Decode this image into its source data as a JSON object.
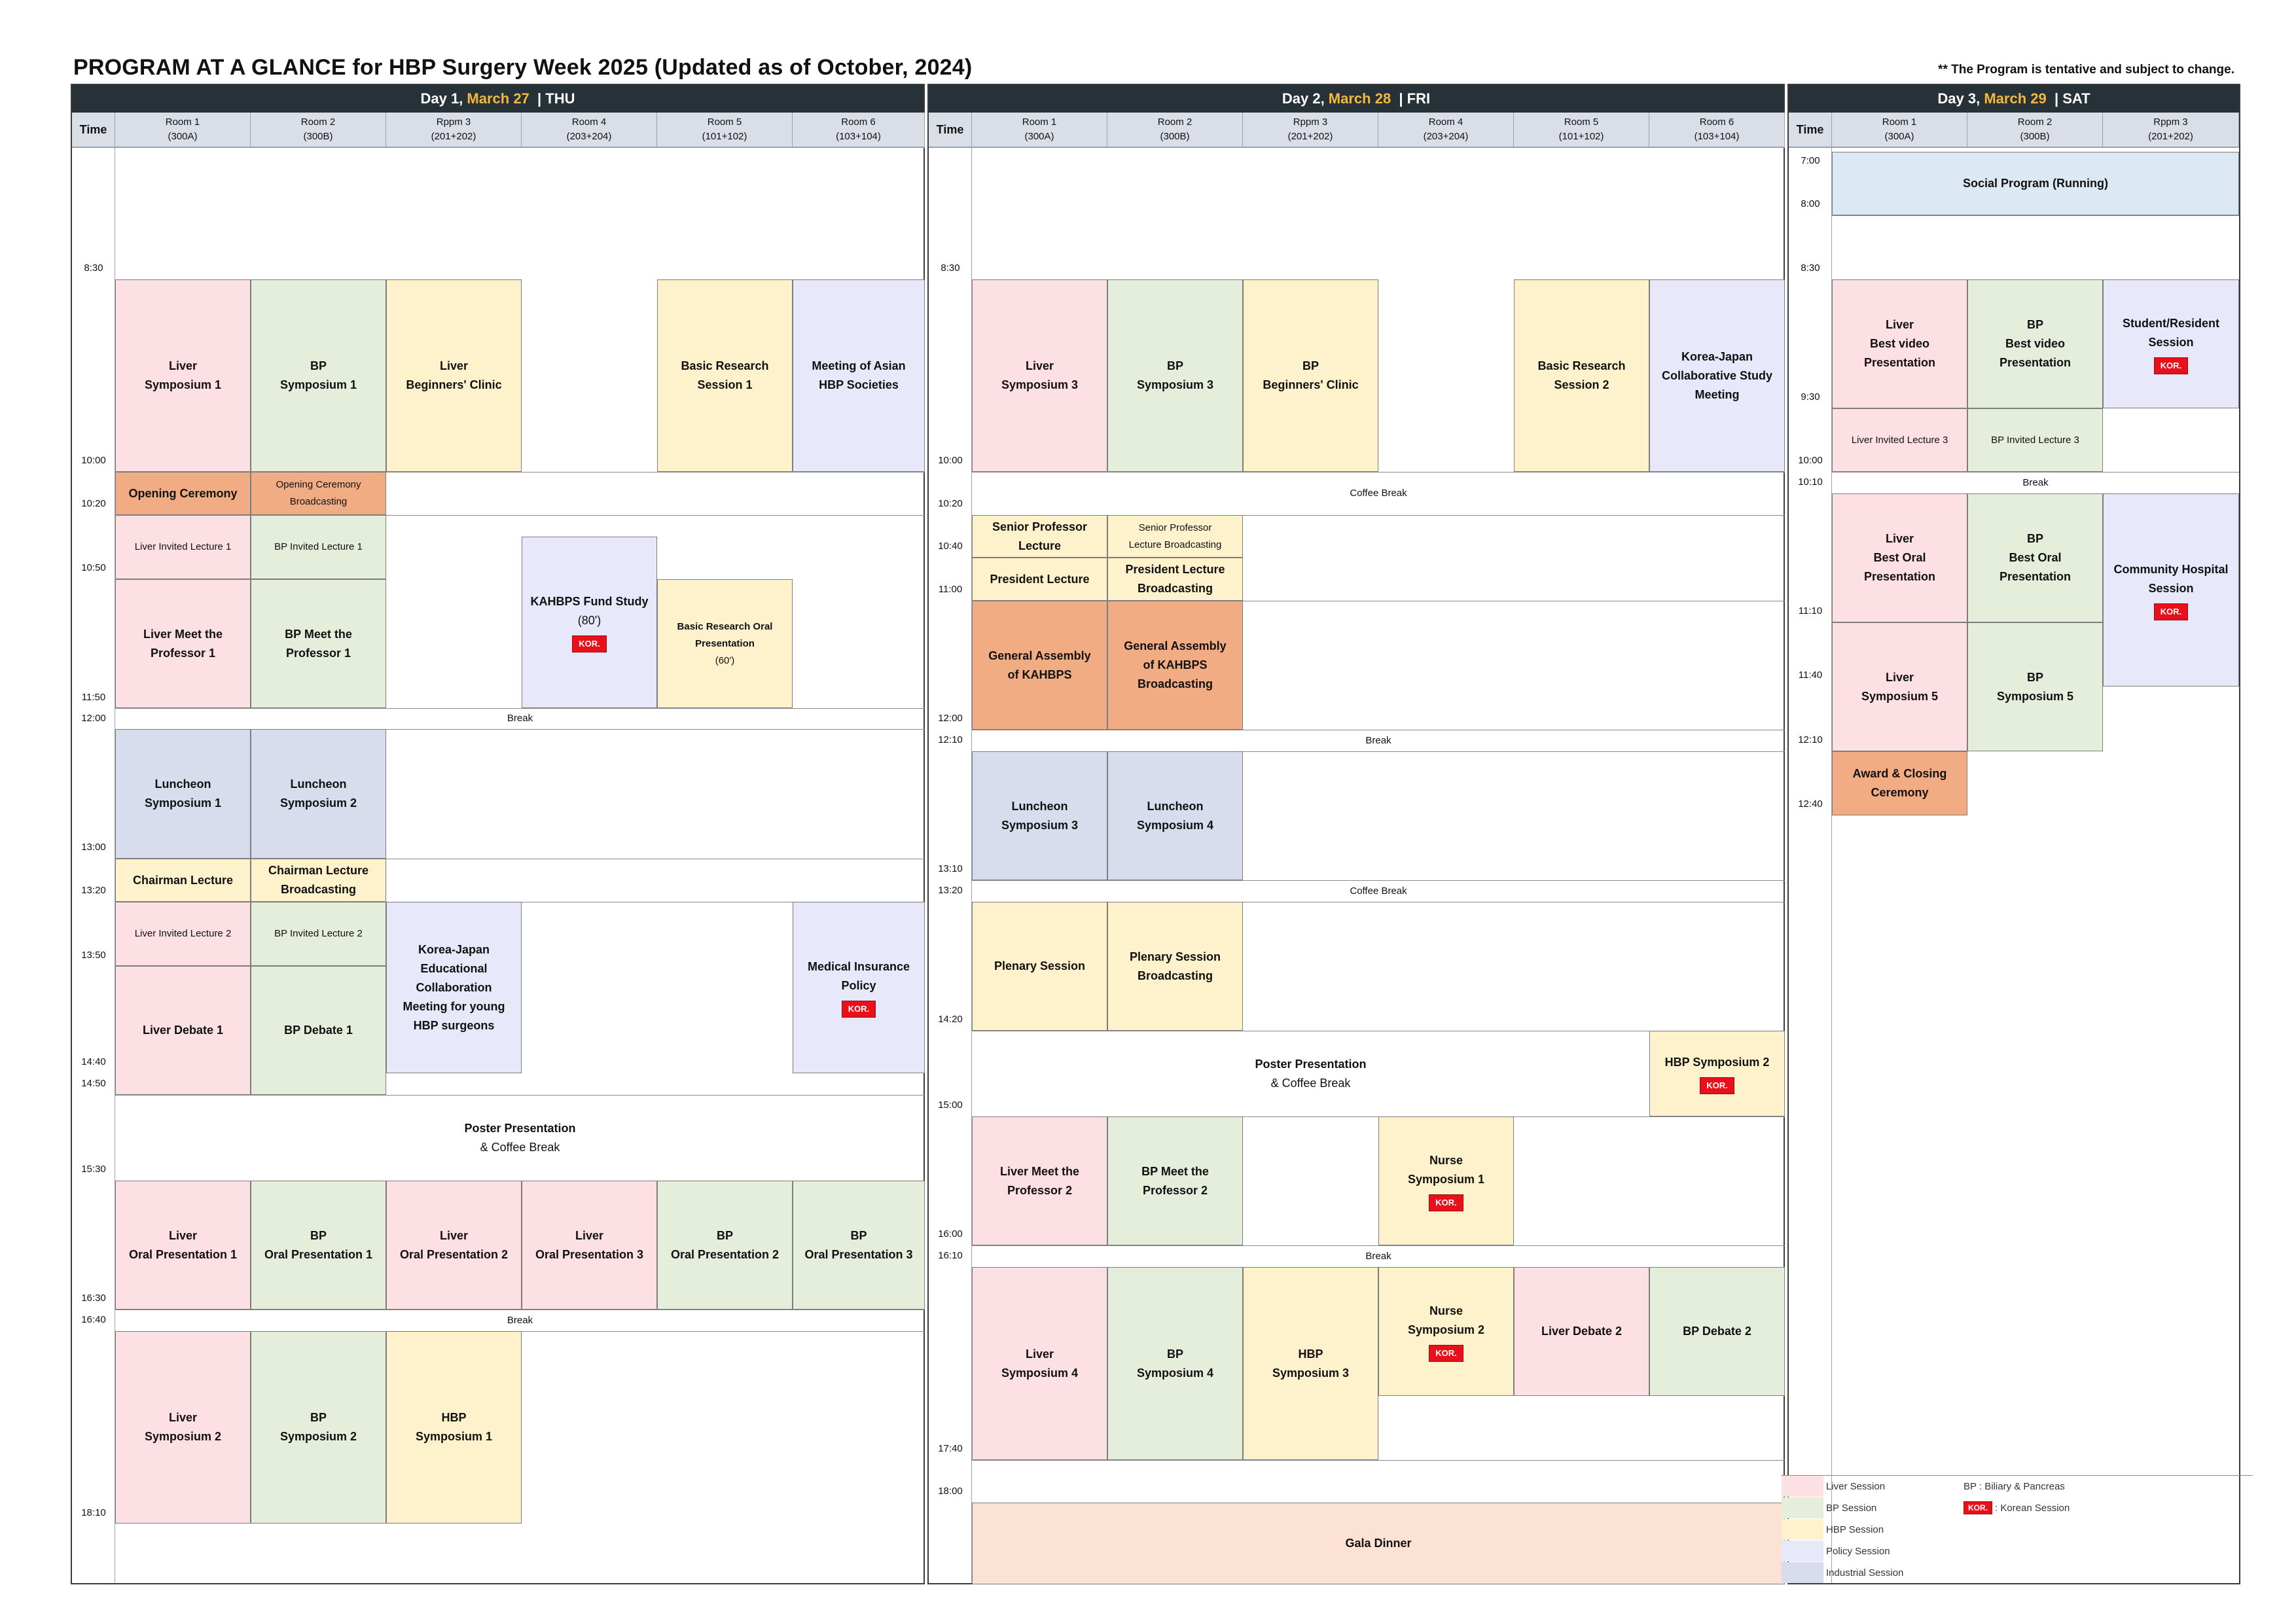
{
  "page": {
    "title": "PROGRAM AT A GLANCE for HBP Surgery Week 2025 (Updated as of October, 2024)",
    "note": "** The Program is tentative and subject to change.",
    "time_header": "Time",
    "kor_badge": "KOR."
  },
  "days": {
    "day1": {
      "label": "Day 1, ",
      "date": "March 27",
      "weekday": "  | THU",
      "rooms": [
        {
          "name": "Room 1",
          "sub": "(300A)"
        },
        {
          "name": "Room 2",
          "sub": "(300B)"
        },
        {
          "name": "Rppm 3",
          "sub": "(201+202)"
        },
        {
          "name": "Room 4",
          "sub": "(203+204)"
        },
        {
          "name": "Room 5",
          "sub": "(101+102)"
        },
        {
          "name": "Room 6",
          "sub": "(103+104)"
        }
      ],
      "times": [
        "8:30",
        "10:00",
        "10:20",
        "10:50",
        "11:50",
        "12:00",
        "13:00",
        "13:20",
        "13:50",
        "14:40",
        "14:50",
        "15:30",
        "16:30",
        "16:40",
        "18:10"
      ],
      "sessions": {
        "liver_sym1": "Liver\nSymposium 1",
        "bp_sym1": "BP\nSymposium 1",
        "liver_beginners": "Liver\nBeginners' Clinic",
        "basic_research1": "Basic Research\nSession 1",
        "asian_meeting": "Meeting of Asian\nHBP Societies",
        "opening": "Opening Ceremony",
        "opening_bc": "Opening Ceremony\nBroadcasting",
        "liver_lecture1": "Liver Invited Lecture 1",
        "bp_lecture1": "BP Invited Lecture 1",
        "kahbps_fund": "KAHBPS Fund Study",
        "kahbps_fund_sub": "(80')",
        "basic_oral": "Basic Research Oral\nPresentation",
        "basic_oral_sub": "(60')",
        "liver_meet1": "Liver Meet the\nProfessor 1",
        "bp_meet1": "BP Meet the\nProfessor 1",
        "break1": "Break",
        "luncheon1": "Luncheon\nSymposium 1",
        "luncheon2": "Luncheon\nSymposium 2",
        "chairman": "Chairman Lecture",
        "chairman_bc": "Chairman Lecture\nBroadcasting",
        "liver_lecture2": "Liver Invited Lecture 2",
        "bp_lecture2": "BP Invited Lecture 2",
        "korea_japan_edu": "Korea-Japan\nEducational\nCollaboration\nMeeting for young\nHBP surgeons",
        "medical_insurance": "Medical Insurance\nPolicy",
        "liver_debate1": "Liver Debate 1",
        "bp_debate1": "BP Debate 1",
        "poster": "Poster Presentation",
        "poster_sub": "& Coffee Break",
        "liver_oral1": "Liver\nOral Presentation 1",
        "bp_oral1": "BP\nOral Presentation 1",
        "liver_oral2": "Liver\nOral Presentation 2",
        "liver_oral3": "Liver\nOral Presentation 3",
        "bp_oral2": "BP\nOral Presentation 2",
        "bp_oral3": "BP\nOral Presentation 3",
        "break2": "Break",
        "liver_sym2": "Liver\nSymposium 2",
        "bp_sym2": "BP\nSymposium 2",
        "hbp_sym1": "HBP\nSymposium 1"
      }
    },
    "day2": {
      "label": "Day 2, ",
      "date": "March 28",
      "weekday": "  | FRI",
      "rooms": [
        {
          "name": "Room 1",
          "sub": "(300A)"
        },
        {
          "name": "Room 2",
          "sub": "(300B)"
        },
        {
          "name": "Rppm 3",
          "sub": "(201+202)"
        },
        {
          "name": "Room 4",
          "sub": "(203+204)"
        },
        {
          "name": "Room 5",
          "sub": "(101+102)"
        },
        {
          "name": "Room 6",
          "sub": "(103+104)"
        }
      ],
      "times": [
        "8:30",
        "10:00",
        "10:20",
        "10:40",
        "11:00",
        "12:00",
        "12:10",
        "13:10",
        "13:20",
        "14:20",
        "15:00",
        "16:00",
        "16:10",
        "17:40",
        "18:00"
      ],
      "sessions": {
        "liver_sym3": "Liver\nSymposium 3",
        "bp_sym3": "BP\nSymposium 3",
        "bp_beginners": "BP\nBeginners' Clinic",
        "basic_research2": "Basic Research\nSession 2",
        "korea_japan_study": "Korea-Japan\nCollaborative Study\nMeeting",
        "coffee1": "Coffee Break",
        "senior_lecture": "Senior Professor\nLecture",
        "senior_lecture_bc": "Senior Professor\nLecture Broadcasting",
        "president": "President Lecture",
        "president_bc": "President Lecture\nBroadcasting",
        "assembly": "General Assembly\nof KAHBPS",
        "assembly_bc": "General Assembly\nof KAHBPS\nBroadcasting",
        "break1": "Break",
        "luncheon3": "Luncheon\nSymposium 3",
        "luncheon4": "Luncheon\nSymposium 4",
        "coffee2": "Coffee Break",
        "plenary": "Plenary Session",
        "plenary_bc": "Plenary Session\nBroadcasting",
        "poster": "Poster Presentation",
        "poster_sub": "& Coffee Break",
        "hbp_sym2": "HBP Symposium 2",
        "liver_meet2": "Liver Meet the\nProfessor 2",
        "bp_meet2": "BP Meet the\nProfessor 2",
        "nurse1": "Nurse\nSymposium 1",
        "break2": "Break",
        "liver_sym4": "Liver\nSymposium 4",
        "bp_sym4": "BP\nSymposium 4",
        "hbp_sym3": "HBP\nSymposium 3",
        "nurse2": "Nurse\nSymposium 2",
        "liver_debate2": "Liver Debate 2",
        "bp_debate2": "BP Debate 2",
        "gala": "Gala Dinner"
      }
    },
    "day3": {
      "label": "Day 3, ",
      "date": "March 29",
      "weekday": "  | SAT",
      "rooms": [
        {
          "name": "Room 1",
          "sub": "(300A)"
        },
        {
          "name": "Room 2",
          "sub": "(300B)"
        },
        {
          "name": "Rppm 3",
          "sub": "(201+202)"
        }
      ],
      "times": [
        "7:00",
        "8:00",
        "8:30",
        "9:30",
        "10:00",
        "10:10",
        "11:10",
        "11:40",
        "12:10",
        "12:40"
      ],
      "sessions": {
        "social": "Social Program (Running)",
        "liver_video": "Liver\nBest video\nPresentation",
        "bp_video": "BP\nBest video\nPresentation",
        "student": "Student/Resident\nSession",
        "liver_lecture3": "Liver Invited Lecture 3",
        "bp_lecture3": "BP Invited Lecture 3",
        "break1": "Break",
        "liver_best_oral": "Liver\nBest Oral\nPresentation",
        "bp_best_oral": "BP\nBest Oral\nPresentation",
        "community": "Community Hospital\nSession",
        "liver_sym5": "Liver\nSymposium 5",
        "bp_sym5": "BP\nSymposium 5",
        "award": "Award & Closing\nCeremony"
      }
    }
  },
  "legend": {
    "items": [
      {
        "label": "Liver Session",
        "color": "#fde0e3"
      },
      {
        "label": "BP Session",
        "color": "#e4eeda"
      },
      {
        "label": "HBP Session",
        "color": "#fef2cc"
      },
      {
        "label": "Policy Session",
        "color": "#e8e8fb"
      },
      {
        "label": "Industrial Session",
        "color": "#d8dded"
      }
    ],
    "bp_note": "BP : Biliary & Pancreas",
    "kor_badge": "KOR.",
    "kor_note": ": Korean Session"
  },
  "colors": {
    "header_bg": "#263238",
    "date_accent": "#f6b73c",
    "kor_badge": "#e8101a",
    "ceremony": "#f2ac84"
  }
}
